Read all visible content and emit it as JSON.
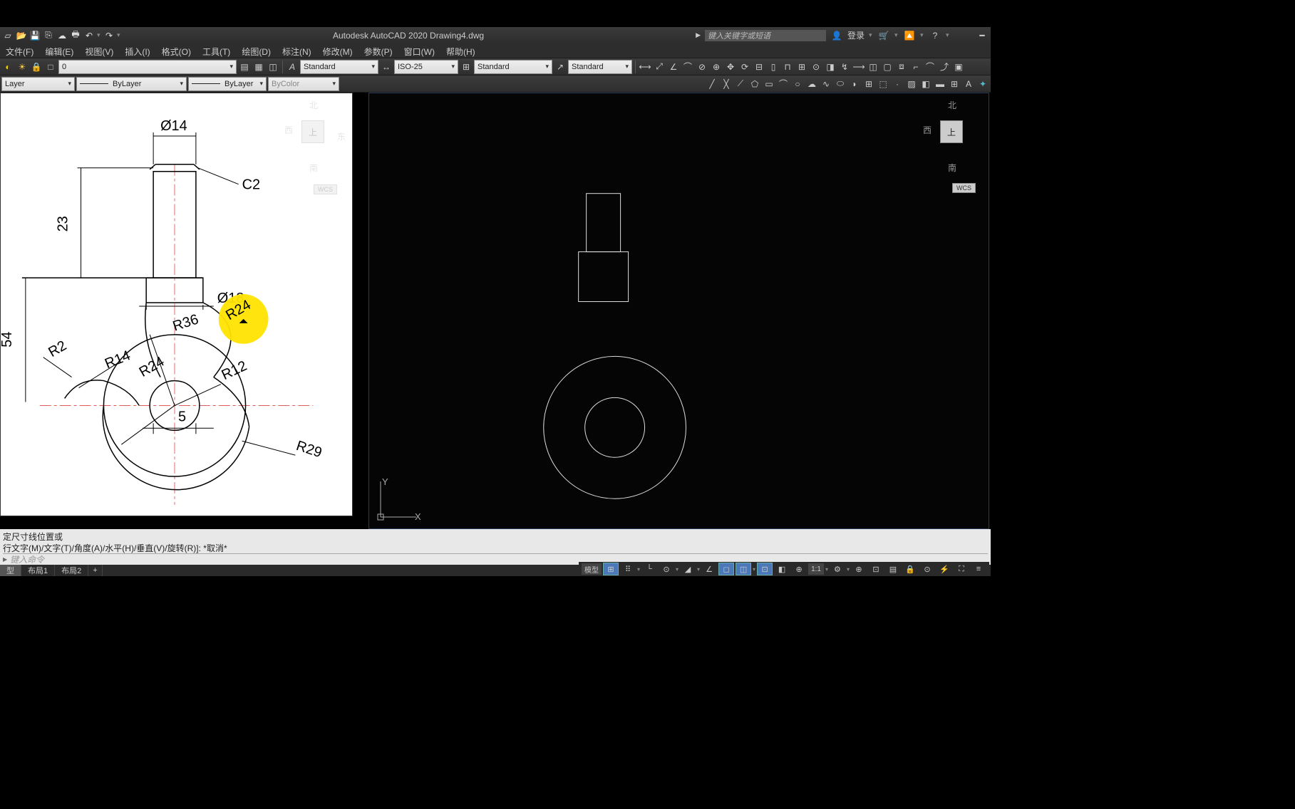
{
  "app": {
    "title": "Autodesk AutoCAD 2020   Drawing4.dwg",
    "search_placeholder": "键入关键字或短语",
    "login": "登录"
  },
  "menu": [
    "文件(F)",
    "编辑(E)",
    "视图(V)",
    "插入(I)",
    "格式(O)",
    "工具(T)",
    "绘图(D)",
    "标注(N)",
    "修改(M)",
    "参数(P)",
    "窗口(W)",
    "帮助(H)"
  ],
  "layer_dd": "0",
  "textstyle": "Standard",
  "dimstyle": "ISO-25",
  "tablestyle": "Standard",
  "mleaderstyle": "Standard",
  "prop": "Layer",
  "linetype": "ByLayer",
  "lineweight": "ByLayer",
  "plotstyle": "ByColor",
  "cmd": {
    "line1": "定尺寸线位置或",
    "line2": "行文字(M)/文字(T)/角度(A)/水平(H)/垂直(V)/旋转(R)]:  *取消*",
    "prompt": "键入命令"
  },
  "tabs": {
    "model": "型",
    "layout1": "布局1",
    "layout2": "布局2"
  },
  "status": {
    "model_btn": "模型",
    "scale": "1:1"
  },
  "viewcube": {
    "n": "北",
    "s": "南",
    "e": "东",
    "w": "西",
    "top": "上",
    "wcs": "WCS"
  },
  "viewcube_ghost": {
    "n": "北",
    "s": "南",
    "e": "东",
    "w": "西",
    "top": "上",
    "wcs": "WCS"
  },
  "ucs": {
    "x": "X",
    "y": "Y"
  },
  "drawing": {
    "dims": {
      "d14": "Ø14",
      "h23": "23",
      "c2": "C2",
      "d18": "Ø18",
      "r24": "R24",
      "r36": "R36",
      "h54": "54",
      "r2": "R2",
      "r14": "R14",
      "r24b": "R24",
      "r12": "R12",
      "s5": "5",
      "r29": "R29"
    }
  }
}
